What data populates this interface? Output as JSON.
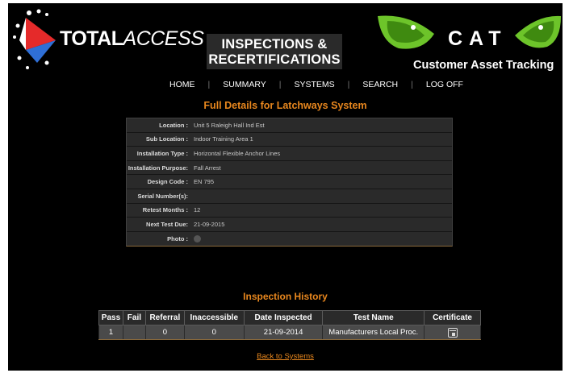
{
  "header": {
    "brand_bold": "TOTAL",
    "brand_thin": "ACCESS",
    "title_line1": "INSPECTIONS &",
    "title_line2": "RECERTIFICATIONS",
    "cat_word": "CAT",
    "cat_tagline": "Customer Asset Tracking"
  },
  "nav": {
    "items": [
      "HOME",
      "SUMMARY",
      "SYSTEMS",
      "SEARCH",
      "LOG OFF"
    ],
    "separator": "|"
  },
  "page_title": "Full Details for Latchways System",
  "details": {
    "location_label": "Location :",
    "location": "Unit 5 Raleigh Hall Ind Est",
    "sub_location_label": "Sub Location :",
    "sub_location": "Indoor Training Area 1",
    "installation_type_label": "Installation Type :",
    "installation_type": "Horizontal Flexible Anchor Lines",
    "installation_purpose_label": "Installation Purpose:",
    "installation_purpose": "Fall Arrest",
    "design_code_label": "Design Code :",
    "design_code": "EN 795",
    "serial_numbers_label": "Serial Number(s):",
    "serial_numbers": "",
    "retest_months_label": "Retest Months :",
    "retest_months": "12",
    "next_test_due_label": "Next Test Due:",
    "next_test_due": "21-09-2015",
    "photo_label": "Photo :"
  },
  "history": {
    "title": "Inspection History",
    "columns": [
      "Pass",
      "Fail",
      "Referral",
      "Inaccessible",
      "Date Inspected",
      "Test Name",
      "Certificate"
    ],
    "rows": [
      {
        "pass": "1",
        "fail": "",
        "referral": "0",
        "inaccessible": "0",
        "date": "21-09-2014",
        "test_name": "Manufacturers Local Proc."
      }
    ]
  },
  "back_link": "Back to Systems",
  "colors": {
    "accent": "#e8871e",
    "background": "#000000",
    "panel": "#2a2a2a",
    "row": "#4a4a4a",
    "logo_red": "#e52a2a",
    "logo_blue": "#2f6fd6",
    "cat_green": "#6dc42a"
  },
  "icons": {
    "photo": "photo-icon",
    "certificate": "certificate-icon"
  }
}
